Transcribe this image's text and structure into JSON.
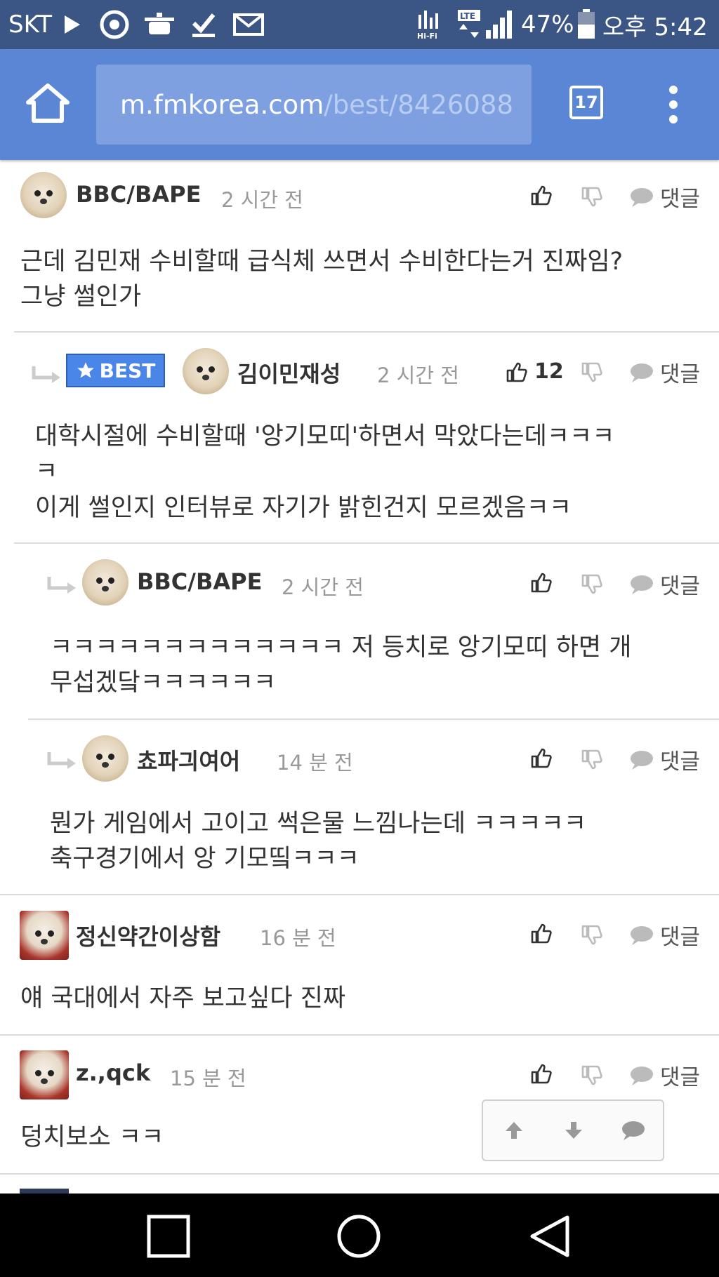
{
  "status_bar": {
    "carrier": "SKT",
    "network": "LTE",
    "hifi": "Hi-Fi",
    "battery": "47%",
    "time": "오후 5:42"
  },
  "browser": {
    "url_host": "m.fmkorea.com",
    "url_path": "/best/8426088",
    "tab_count": "17"
  },
  "comments": [
    {
      "author": "BBC/BAPE",
      "time": "2 시간 전",
      "lines": [
        "근데 김민재 수비할때 급식체 쓰면서 수비한다는거 진짜임?",
        "그냥 썰인가"
      ],
      "reply_label": "댓글"
    },
    {
      "badge": "BEST",
      "author": "김이민재성",
      "time": "2 시간 전",
      "likes": "12",
      "lines": [
        "대학시절에 수비할때 '앙기모띠'하면서 막았다는데ㅋㅋㅋ",
        "ㅋ",
        "이게 썰인지 인터뷰로 자기가 밝힌건지 모르겠음ㅋㅋ"
      ],
      "reply_label": "댓글"
    },
    {
      "author": "BBC/BAPE",
      "time": "2 시간 전",
      "lines": [
        "ㅋㅋㅋㅋㅋㅋㅋㅋㅋㅋㅋㅋㅋ 저 등치로 앙기모띠 하면 개",
        "무섭겠닼ㅋㅋㅋㅋㅋㅋ"
      ],
      "reply_label": "댓글"
    },
    {
      "author": "쵸파긔여어",
      "time": "14 분 전",
      "lines": [
        "뭔가 게임에서 고이고 썩은물 느낌나는데 ㅋㅋㅋㅋㅋ",
        "축구경기에서 앙 기모띸ㅋㅋㅋ"
      ],
      "reply_label": "댓글"
    },
    {
      "author": "정신약간이상함",
      "time": "16 분 전",
      "lines": [
        "얘 국대에서 자주 보고싶다 진짜"
      ],
      "reply_label": "댓글"
    },
    {
      "author": "z.,qck",
      "time": "15 분 전",
      "lines": [
        "덩치보소 ㅋㅋ"
      ],
      "reply_label": "댓글"
    }
  ],
  "colors": {
    "status_bar": "#3b5584",
    "browser_bar": "#5b86d6",
    "url_box": "#7ea0e0",
    "best_badge": "#4a86e8"
  },
  "icons": [
    "home-icon",
    "tabs-icon",
    "more-vert-icon",
    "thumb-up-icon",
    "thumb-down-icon",
    "comment-bubble-icon",
    "reply-arrow-icon",
    "arrow-up-icon",
    "arrow-down-icon",
    "back-nav-icon",
    "home-nav-icon",
    "recents-nav-icon"
  ]
}
